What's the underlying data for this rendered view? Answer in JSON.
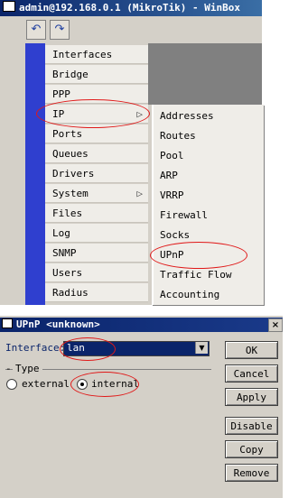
{
  "winbox": {
    "title": "admin@192.168.0.1 (MikroTik) - WinBox",
    "undo_label": "↶",
    "redo_label": "↷",
    "menu": [
      {
        "label": "Interfaces"
      },
      {
        "label": "Bridge"
      },
      {
        "label": "PPP"
      },
      {
        "label": "IP",
        "has_submenu": true
      },
      {
        "label": "Ports"
      },
      {
        "label": "Queues"
      },
      {
        "label": "Drivers"
      },
      {
        "label": "System",
        "has_submenu": true
      },
      {
        "label": "Files"
      },
      {
        "label": "Log"
      },
      {
        "label": "SNMP"
      },
      {
        "label": "Users"
      },
      {
        "label": "Radius"
      }
    ],
    "submenu_arrow": "▷",
    "ip_submenu": [
      {
        "label": "Addresses"
      },
      {
        "label": "Routes"
      },
      {
        "label": "Pool"
      },
      {
        "label": "ARP"
      },
      {
        "label": "VRRP"
      },
      {
        "label": "Firewall"
      },
      {
        "label": "Socks"
      },
      {
        "label": "UPnP"
      },
      {
        "label": "Traffic Flow"
      },
      {
        "label": "Accounting"
      }
    ]
  },
  "dialog": {
    "title": "UPnP <unknown>",
    "close_label": "×",
    "interface_label": "Interface:",
    "interface_value": "lan",
    "dropdown_glyph": "▼",
    "type_legend": "Type",
    "type_options": [
      {
        "label": "external",
        "selected": false
      },
      {
        "label": "internal",
        "selected": true
      }
    ],
    "buttons": {
      "ok": "OK",
      "cancel": "Cancel",
      "apply": "Apply",
      "disable": "Disable",
      "copy": "Copy",
      "remove": "Remove"
    }
  },
  "colors": {
    "titlebar": "#0a246a",
    "menu_strip": "#2f3fcf",
    "annotation": "#e01818"
  }
}
